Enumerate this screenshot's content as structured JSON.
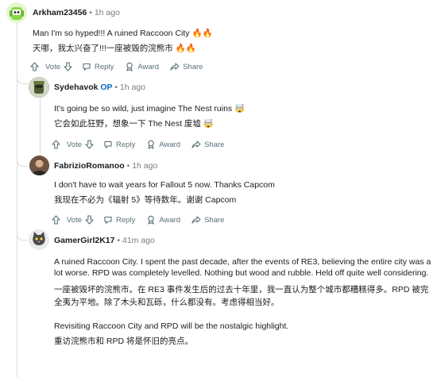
{
  "comments": [
    {
      "username": "Arkham23456",
      "time": "1h ago",
      "lines": [
        "Man I'm so hyped!!! A ruined Raccoon City 🔥🔥",
        "天哪，我太兴奋了!!!一座被毁的浣熊市 🔥🔥"
      ],
      "actions": {
        "vote": "Vote",
        "reply": "Reply",
        "award": "Award",
        "share": "Share"
      }
    },
    {
      "username": "Sydehavok",
      "op_badge": "OP",
      "time": "1h ago",
      "lines": [
        "It's going be so wild, just imagine The Nest ruins 🤯",
        "它会如此狂野，想象一下 The Nest 废墟 🤯"
      ],
      "actions": {
        "vote": "Vote",
        "reply": "Reply",
        "award": "Award",
        "share": "Share"
      }
    },
    {
      "username": "FabrizioRomanoo",
      "time": "1h ago",
      "lines": [
        "I don't have to wait years for Fallout 5 now. Thanks Capcom",
        "我现在不必为《辐射 5》等待数年。谢谢 Capcom"
      ],
      "actions": {
        "vote": "Vote",
        "reply": "Reply",
        "award": "Award",
        "share": "Share"
      }
    },
    {
      "username": "GamerGirl2K17",
      "time": "41m ago",
      "paragraph1": "A ruined Raccoon City. I spent the past decade, after the events of RE3, believing the entire city was a lot worse. RPD was completely levelled. Nothing but wood and rubble. Held off quite well considering.",
      "paragraph1_zh": "一座被毁坏的浣熊市。在 RE3 事件发生后的过去十年里，我一直认为整个城市都糟糕得多。RPD 被完全夷为平地。除了木头和瓦砾，什么都没有。考虑得相当好。",
      "paragraph2": "Revisiting Raccoon City and RPD will be the nostalgic highlight.",
      "paragraph2_zh": "重访浣熊市和 RPD 将是怀旧的亮点。"
    }
  ],
  "separator": "•",
  "colors": {
    "op": "#0a66c2",
    "meta": "#7c7c7c",
    "action": "#576f76",
    "thread": "#d7dadc"
  }
}
